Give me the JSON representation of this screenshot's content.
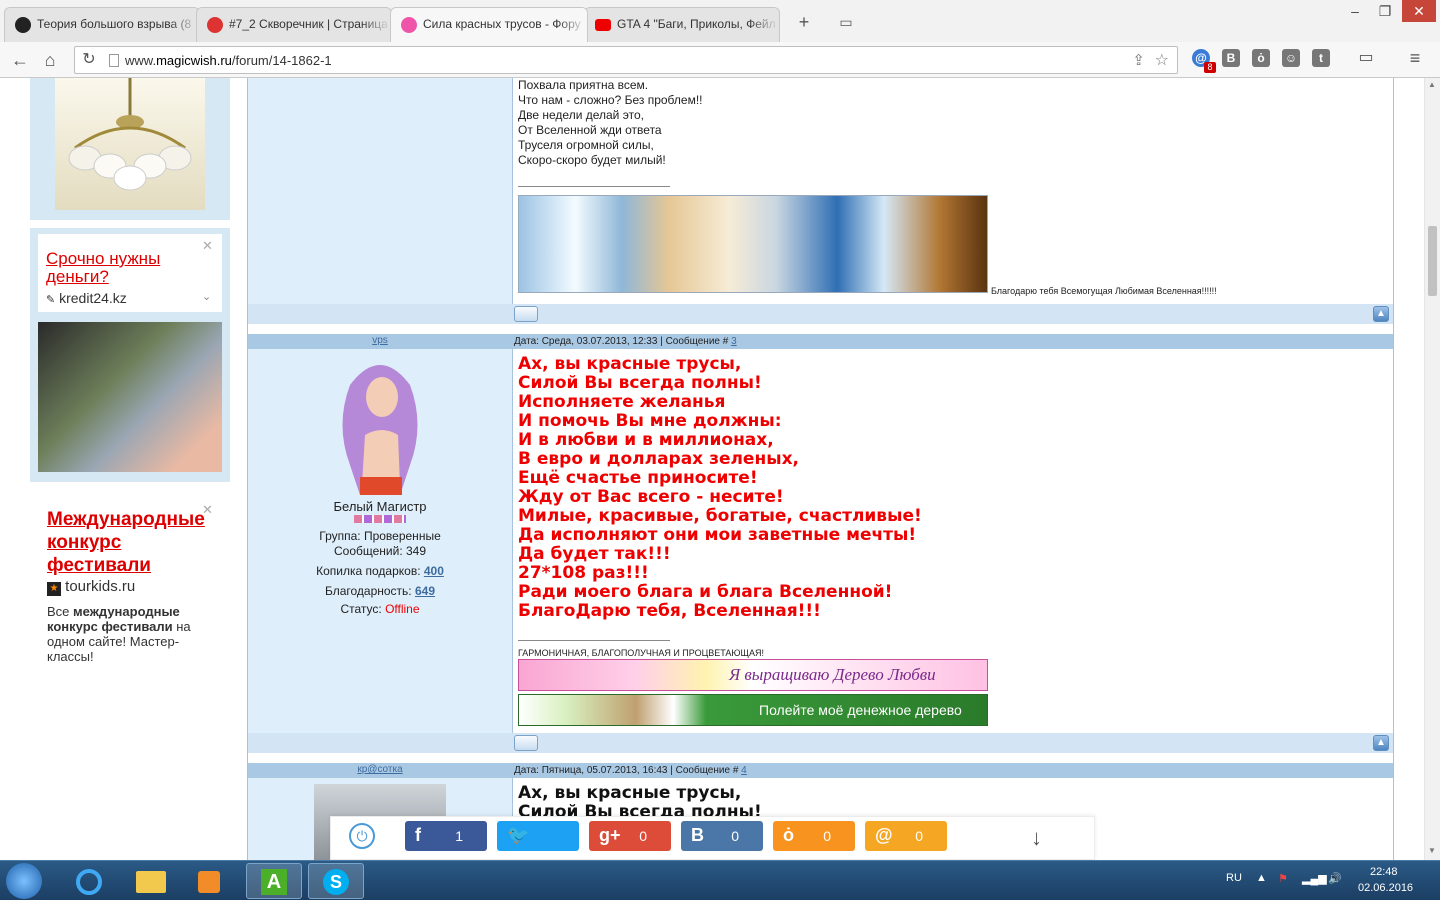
{
  "browser": {
    "tabs": [
      {
        "title": "Теория большого взрыва (8",
        "favicon": "face-icon"
      },
      {
        "title": "#7_2 Скворечник | Страница",
        "favicon": "heart-icon"
      },
      {
        "title": "Сила красных трусов - Фору",
        "favicon": "flower-icon",
        "active": true
      },
      {
        "title": "GTA 4 \"Баги, Приколы, Фейл",
        "favicon": "youtube-icon"
      }
    ],
    "new_tab_symbol": "+",
    "url_scheme": "www.",
    "url_domain": "magicwish.ru",
    "url_path": "/forum/14-1862-1",
    "ext_badge": "8",
    "window_controls": {
      "minimize": "–",
      "restore": "❐",
      "close": "✕"
    }
  },
  "left_ads": {
    "ad1": {
      "title": "Срочно нужны деньги?",
      "domain": "kredit24.kz"
    },
    "ad2": {
      "title": "Международные конкурс фестивали",
      "domain": "tourkids.ru",
      "body_prefix": "Все ",
      "body_bold": "международные конкурс фестивали",
      "body_suffix": " на одном сайте! Мастер-классы!"
    }
  },
  "post1": {
    "lines": [
      "Похвала приятна всем.",
      "Что нам - сложно? Без проблем!!",
      "Две недели делай это,",
      "От Вселенной жди ответа",
      "Труселя огромной силы,",
      "Скоро-скоро будет милый!"
    ],
    "caption": "Благодарю тебя Всемогущая Любимая Вселенная!!!!!!"
  },
  "post2": {
    "header_name": "vps",
    "header_date": "Дата: Среда, 03.07.2013, 12:33 | Сообщение # ",
    "header_num": "3",
    "user_title": "Белый Магистр",
    "group": "Группа: Проверенные",
    "messages": "Сообщений: 349",
    "gifts_label": "Копилка подарков: ",
    "gifts_value": "400",
    "thanks_label": "Благодарность: ",
    "thanks_value": "649",
    "status_label": "Статус: ",
    "status_value": "Offline",
    "lines": [
      "Ах, вы красные трусы,",
      "Силой Вы всегда полны!",
      "Исполняете желанья",
      "И помочь Вы мне должны:",
      "И в любви и в миллионах,",
      "В евро и долларах зеленых,",
      "Ещё счастье приносите!",
      "Жду от Вас всего - несите!",
      "Милые, красивые, богатые, счастливые!",
      "Да исполняют они мои заветные мечты!",
      "Да будет так!!!",
      "27*108 раз!!!",
      "Ради моего блага и блага Вселенной!",
      "БлагоДарю тебя, Вселенная!!!"
    ],
    "signature": "ГАРМОНИЧНАЯ, БЛАГОПОЛУЧНАЯ И ПРОЦВЕТАЮЩАЯ!",
    "banner1": "Я выращиваю Дерево Любви",
    "banner2": "Полейте моё денежное дерево"
  },
  "post3": {
    "header_name": "кр@сотка",
    "header_date": "Дата: Пятница, 05.07.2013, 16:43 | Сообщение # ",
    "header_num": "4",
    "lines": [
      "Ах, вы красные трусы,",
      "Силой Вы всегда полны!"
    ]
  },
  "share": [
    {
      "icon": "f",
      "count": "1",
      "color": "#3b5998",
      "name": "facebook"
    },
    {
      "icon": "t",
      "count": "",
      "color": "#1da1f2",
      "name": "twitter"
    },
    {
      "icon": "g+",
      "count": "0",
      "color": "#dd4b39",
      "name": "google-plus"
    },
    {
      "icon": "B",
      "count": "0",
      "color": "#4a76a8",
      "name": "vkontakte"
    },
    {
      "icon": "ok",
      "count": "0",
      "color": "#f7931e",
      "name": "odnoklassniki"
    },
    {
      "icon": "@",
      "count": "0",
      "color": "#f5a623",
      "name": "mail-ru"
    }
  ],
  "taskbar": {
    "lang": "RU",
    "time": "22:48",
    "date": "02.06.2016"
  }
}
